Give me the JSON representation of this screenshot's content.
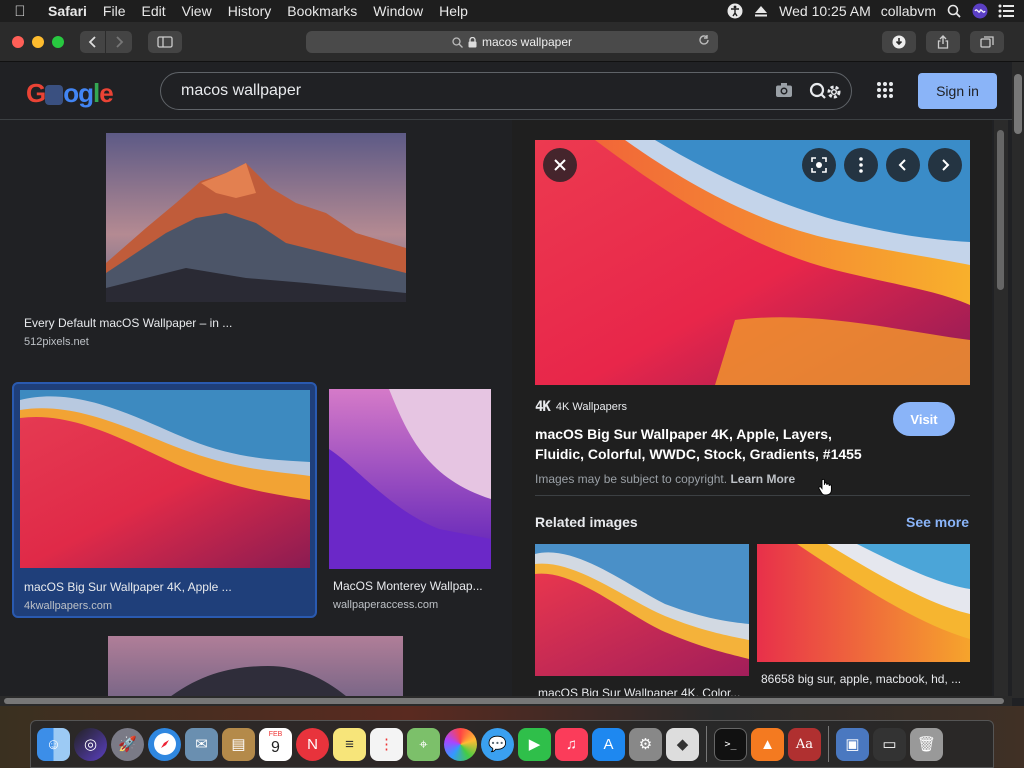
{
  "menubar": {
    "app": "Safari",
    "items": [
      "File",
      "Edit",
      "View",
      "History",
      "Bookmarks",
      "Window",
      "Help"
    ],
    "clock": "Wed 10:25 AM",
    "user": "collabvm"
  },
  "browser": {
    "url": "macos wallpaper"
  },
  "google": {
    "logo": "Google",
    "query": "macos wallpaper",
    "signin": "Sign in"
  },
  "results": [
    {
      "caption": "Every Default macOS Wallpaper – in ...",
      "source": "512pixels.net"
    },
    {
      "caption": "macOS Big Sur Wallpaper 4K, Apple ...",
      "source": "4kwallpapers.com"
    },
    {
      "caption": "MacOS Monterey Wallpap...",
      "source": "wallpaperaccess.com"
    }
  ],
  "preview": {
    "site_logo": "4K",
    "site": "4K Wallpapers",
    "title": "macOS Big Sur Wallpaper 4K, Apple, Layers, Fluidic, Colorful, WWDC, Stock, Gradients, #1455",
    "visit": "Visit",
    "copyright": "Images may be subject to copyright.",
    "learn_more": "Learn More",
    "related_heading": "Related images",
    "see_more": "See more",
    "related": [
      {
        "caption": "macOS Big Sur Wallpaper 4K, Color..."
      },
      {
        "caption": "86658 big sur, apple, macbook, hd, ..."
      }
    ]
  },
  "dock": {
    "calendar_month": "FEB",
    "calendar_day": "9"
  }
}
